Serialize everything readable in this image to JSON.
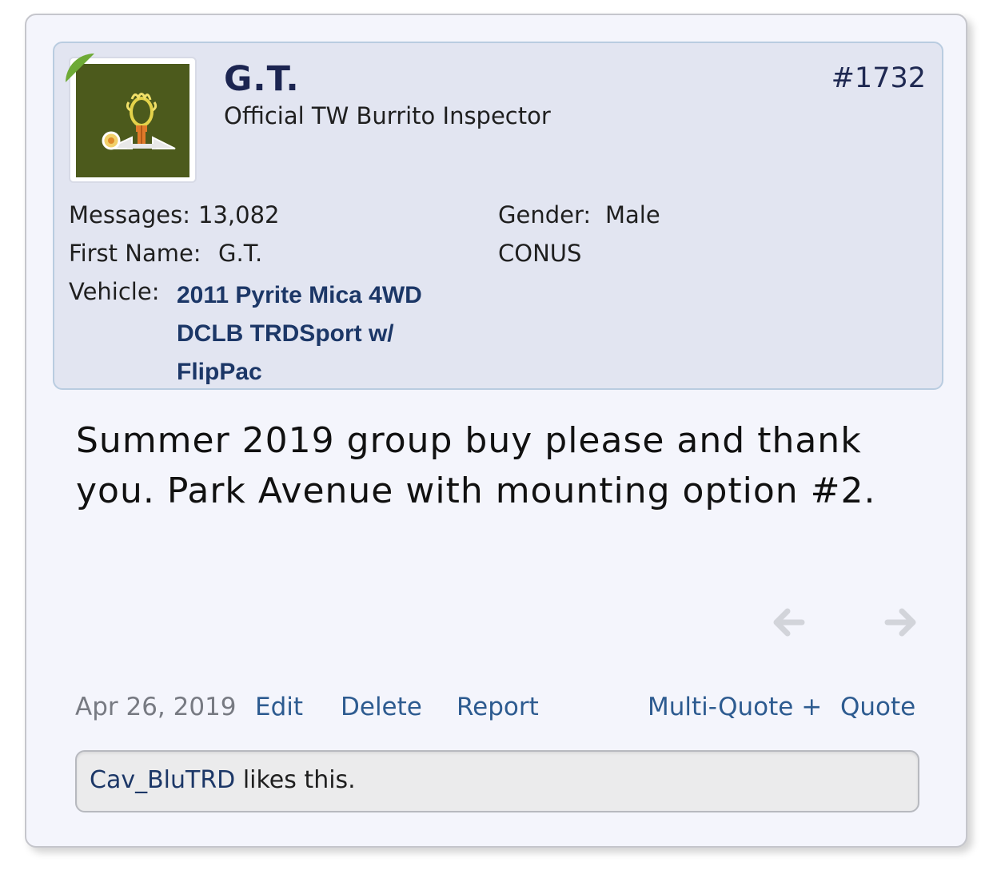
{
  "user": {
    "username": "G.T.",
    "title": "Official TW Burrito Inspector",
    "post_number": "#1732",
    "avatar_icon": "hoop-avatar-icon",
    "fields": {
      "messages_label": "Messages:",
      "messages_value": "13,082",
      "first_name_label": "First Name:",
      "first_name_value": "G.T.",
      "vehicle_label": "Vehicle:",
      "vehicle_value": "2011 Pyrite Mica 4WD DCLB TRDSport w/ FlipPac",
      "gender_label": "Gender:",
      "gender_value": "Male",
      "location": "CONUS"
    }
  },
  "post": {
    "message": "Summer 2019 group buy please and thank you. Park Avenue with mounting option #2."
  },
  "nav": {
    "prev_icon": "arrow-left-icon",
    "next_icon": "arrow-right-icon"
  },
  "footer": {
    "date": "Apr 26, 2019",
    "edit": "Edit",
    "delete": "Delete",
    "report": "Report",
    "multi_quote": "Multi-Quote +",
    "quote": "Quote"
  },
  "likes": {
    "user": "Cav_BluTRD",
    "suffix": " likes this."
  },
  "colors": {
    "card_bg": "#f4f5fc",
    "panel_bg": "#e2e5f1",
    "username": "#1c2551",
    "link": "#2d5b90",
    "avatar_bg": "#4c5a1c"
  }
}
